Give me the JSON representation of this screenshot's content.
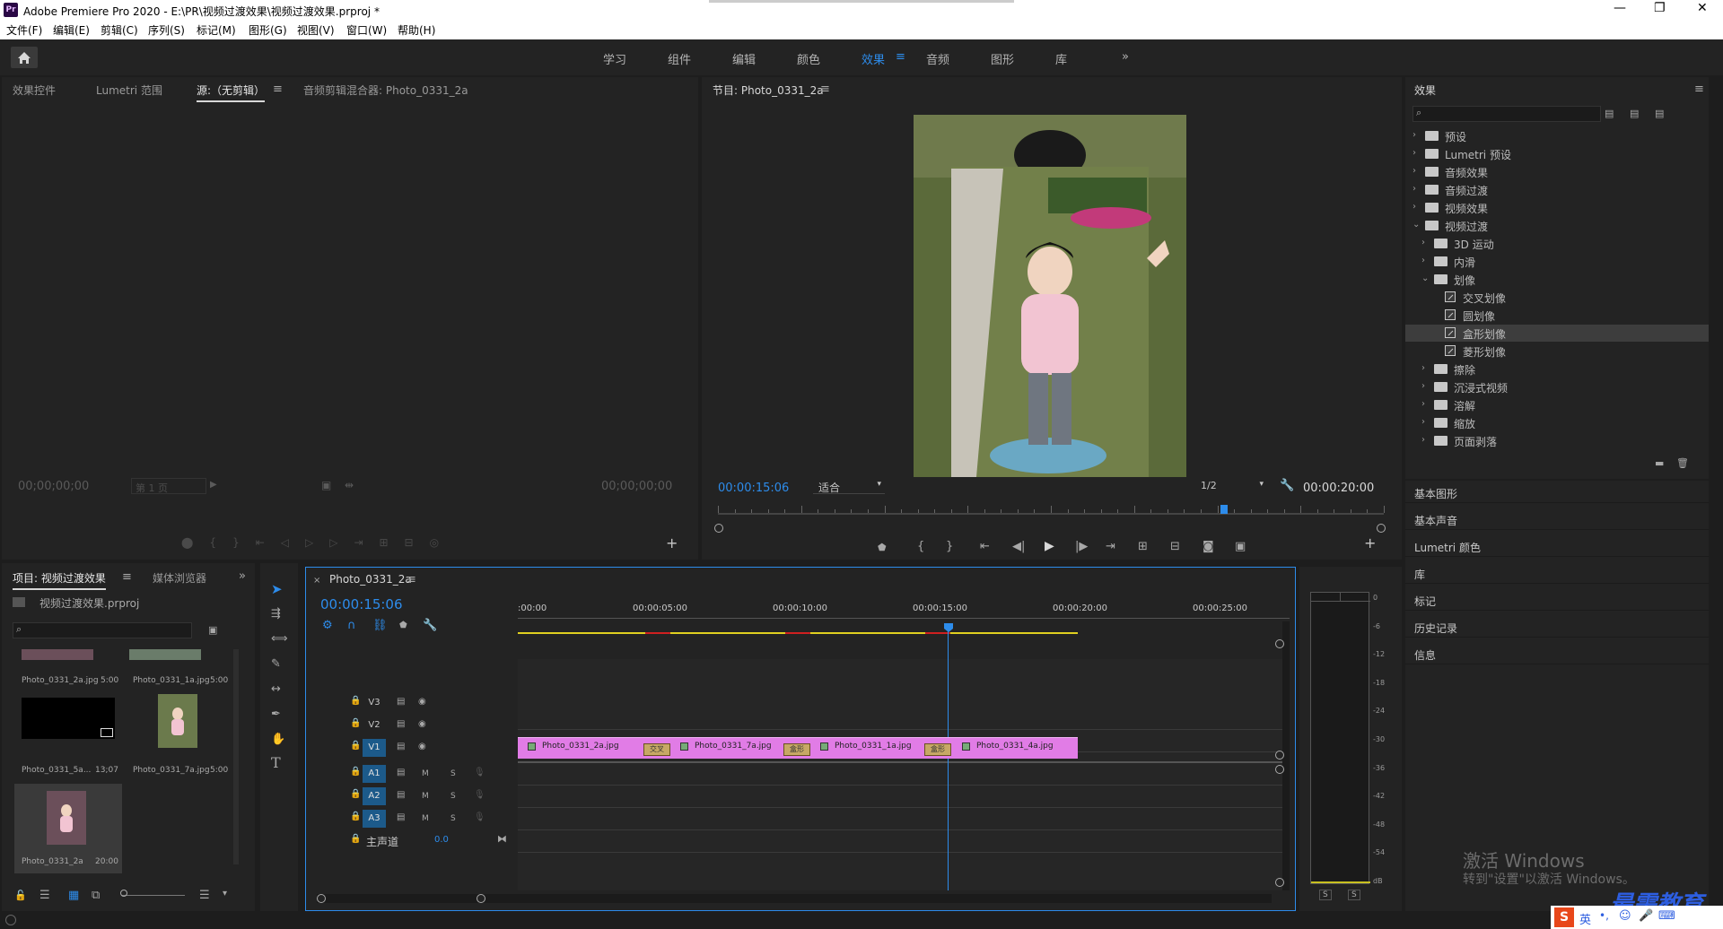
{
  "window": {
    "title": "Adobe Premiere Pro 2020 - E:\\PR\\视频过渡效果\\视频过渡效果.prproj *",
    "logo": "Pr"
  },
  "menu": [
    "文件(F)",
    "编辑(E)",
    "剪辑(C)",
    "序列(S)",
    "标记(M)",
    "图形(G)",
    "视图(V)",
    "窗口(W)",
    "帮助(H)"
  ],
  "workspaces": [
    "学习",
    "组件",
    "编辑",
    "颜色",
    "效果",
    "音频",
    "图形",
    "库"
  ],
  "workspace_active": "效果",
  "source_panel": {
    "tabs": [
      "效果控件",
      "Lumetri 范围",
      "源:（无剪辑）",
      "音频剪辑混合器: Photo_0331_2a"
    ],
    "timecode_left": "00;00;00;00",
    "timecode_right": "00;00;00;00",
    "page_select": "第 1 页"
  },
  "program_panel": {
    "title": "节目: Photo_0331_2a",
    "timecode": "00:00:15:06",
    "fit": "适合",
    "resolution": "1/2",
    "duration": "00:00:20:00",
    "playhead_fraction": 0.76
  },
  "effects_panel": {
    "title": "效果",
    "search_placeholder": "",
    "tree": [
      {
        "label": "预设",
        "type": "folder",
        "level": 0,
        "expanded": false
      },
      {
        "label": "Lumetri 预设",
        "type": "folder",
        "level": 0,
        "expanded": false
      },
      {
        "label": "音频效果",
        "type": "folder",
        "level": 0,
        "expanded": false
      },
      {
        "label": "音频过渡",
        "type": "folder",
        "level": 0,
        "expanded": false
      },
      {
        "label": "视频效果",
        "type": "folder",
        "level": 0,
        "expanded": false
      },
      {
        "label": "视频过渡",
        "type": "folder",
        "level": 0,
        "expanded": true
      },
      {
        "label": "3D 运动",
        "type": "folder",
        "level": 1,
        "expanded": false
      },
      {
        "label": "内滑",
        "type": "folder",
        "level": 1,
        "expanded": false
      },
      {
        "label": "划像",
        "type": "folder",
        "level": 1,
        "expanded": true
      },
      {
        "label": "交叉划像",
        "type": "effect",
        "level": 2
      },
      {
        "label": "圆划像",
        "type": "effect",
        "level": 2
      },
      {
        "label": "盒形划像",
        "type": "effect",
        "level": 2,
        "selected": true
      },
      {
        "label": "菱形划像",
        "type": "effect",
        "level": 2
      },
      {
        "label": "擦除",
        "type": "folder",
        "level": 1,
        "expanded": false
      },
      {
        "label": "沉浸式视频",
        "type": "folder",
        "level": 1,
        "expanded": false
      },
      {
        "label": "溶解",
        "type": "folder",
        "level": 1,
        "expanded": false
      },
      {
        "label": "缩放",
        "type": "folder",
        "level": 1,
        "expanded": false
      },
      {
        "label": "页面剥落",
        "type": "folder",
        "level": 1,
        "expanded": false
      }
    ]
  },
  "side_panels": [
    "基本图形",
    "基本声音",
    "Lumetri 颜色",
    "库",
    "标记",
    "历史记录",
    "信息"
  ],
  "project_panel": {
    "tabs": [
      "项目: 视频过渡效果",
      "媒体浏览器"
    ],
    "file": "视频过渡效果.prproj",
    "items": [
      {
        "name": "Photo_0331_2a.jpg",
        "dur": "5:00"
      },
      {
        "name": "Photo_0331_1a.jpg",
        "dur": "5:00"
      },
      {
        "name": "Photo_0331_5a...",
        "dur": "13;07"
      },
      {
        "name": "Photo_0331_7a.jpg",
        "dur": "5:00"
      },
      {
        "name": "Photo_0331_2a",
        "dur": "20:00"
      }
    ]
  },
  "timeline": {
    "tab": "Photo_0331_2a",
    "timecode": "00:00:15:06",
    "ruler": [
      ":00:00",
      "00:00:05:00",
      "00:00:10:00",
      "00:00:15:00",
      "00:00:20:00",
      "00:00:25:00"
    ],
    "tracks_video": [
      "V3",
      "V2",
      "V1"
    ],
    "tracks_audio": [
      "A1",
      "A2",
      "A3"
    ],
    "master": {
      "label": "主声道",
      "value": "0.0"
    },
    "clips": [
      {
        "name": "Photo_0331_2a.jpg"
      },
      {
        "name": "Photo_0331_7a.jpg"
      },
      {
        "name": "Photo_0331_1a.jpg"
      },
      {
        "name": "Photo_0331_4a.jpg"
      }
    ],
    "transitions": [
      "交叉",
      "盒形",
      "盒形"
    ]
  },
  "meter": {
    "scale": [
      "0",
      "-6",
      "-12",
      "-18",
      "-24",
      "-30",
      "-36",
      "-42",
      "-48",
      "-54",
      "dB"
    ],
    "solo": [
      "S",
      "S"
    ]
  },
  "watermark": {
    "line1": "激活 Windows",
    "line2": "转到\"设置\"以激活 Windows。",
    "brand": "最需教育"
  },
  "ime": {
    "lang": "英"
  }
}
